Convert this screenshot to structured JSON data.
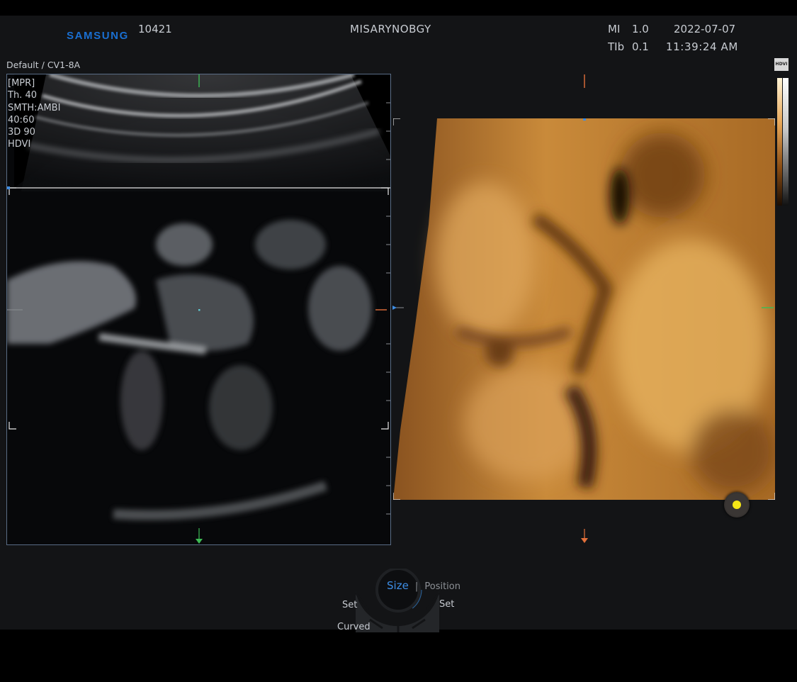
{
  "header": {
    "brand": "SAMSUNG",
    "patient_id": "10421",
    "department": "MISARYNOBGY",
    "mi_label": "MI",
    "mi_value": "1.0",
    "tib_label": "TIb",
    "tib_value": "0.1",
    "date": "2022-07-07",
    "time": "11:39:24 AM"
  },
  "preset": "Default / CV1-8A",
  "mpr_params": [
    "[MPR]",
    "Th. 40",
    "SMTH:AMBI",
    "40:60",
    "3D 90",
    "HDVI"
  ],
  "scale_badge": "HDVI",
  "control_knob": {
    "tab_active": "Size",
    "separator": "|",
    "tab_inactive": "Position",
    "left_label": "Set",
    "right_label": "Set",
    "bottom_label": "Curved"
  },
  "colors": {
    "brand_blue": "#1a6fd1",
    "active_tab_blue": "#3d8ee6",
    "render_orange": "#c98a3a",
    "indicator_yellow": "#f5e616"
  },
  "icons": {
    "marker_top_left": "green-tick-marker",
    "marker_bottom_left": "green-arrow-down",
    "marker_right_orange": "orange-arrow-marker",
    "marker_right_green": "green-arrow-marker"
  }
}
